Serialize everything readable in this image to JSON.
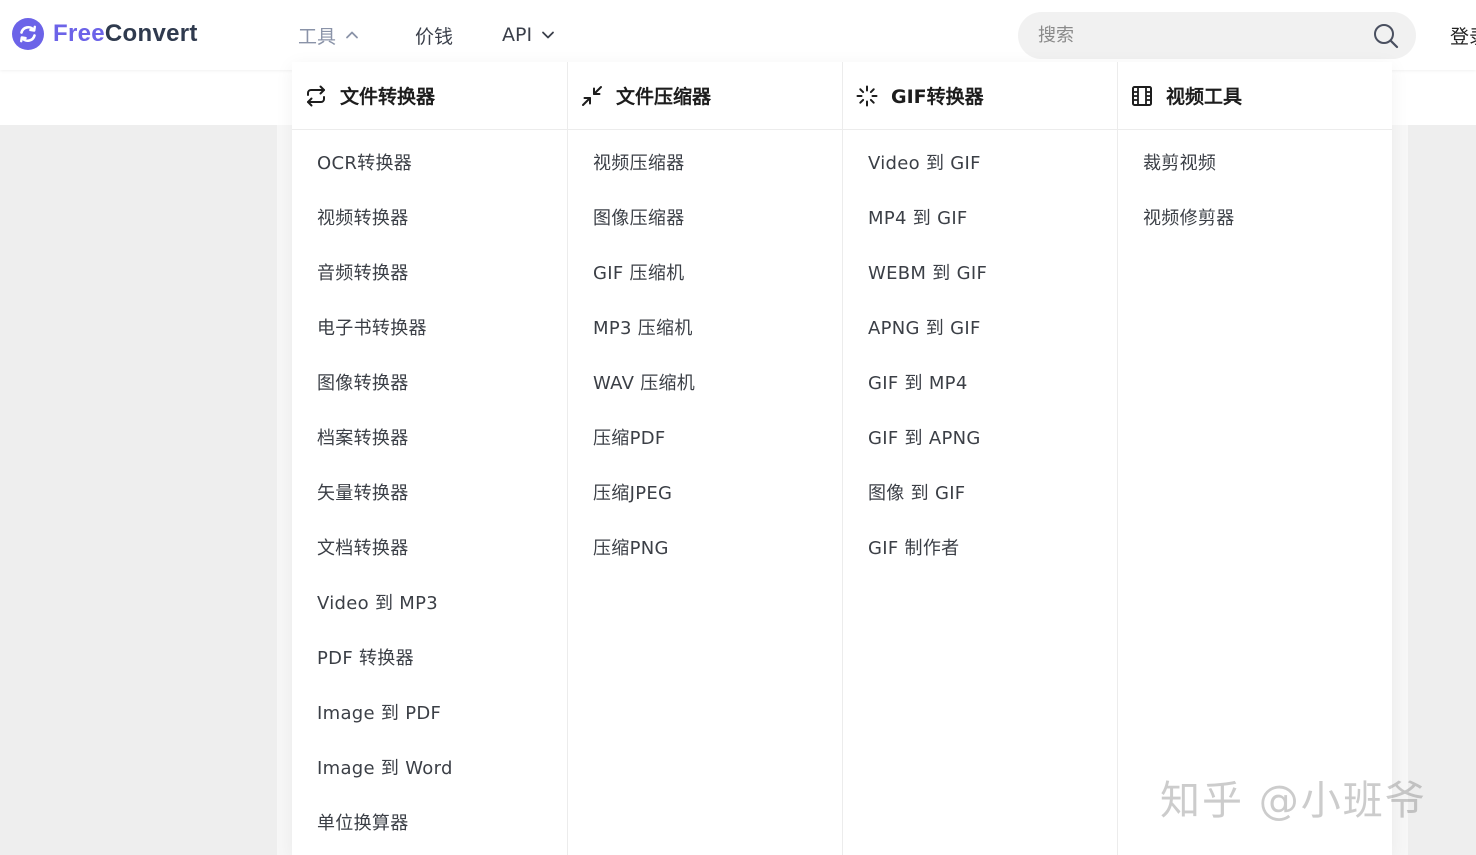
{
  "header": {
    "logo": {
      "free": "Free",
      "convert": "Convert"
    },
    "nav": {
      "tools_label": "工具",
      "price_label": "价钱",
      "api_label": "API"
    },
    "search": {
      "placeholder": "搜索"
    },
    "login_label": "登录"
  },
  "menu": {
    "columns": [
      {
        "title": "文件转换器",
        "icon": "convert-arrows-icon",
        "items": [
          "OCR转换器",
          "视频转换器",
          "音频转换器",
          "电子书转换器",
          "图像转换器",
          "档案转换器",
          "矢量转换器",
          "文档转换器",
          "Video 到 MP3",
          "PDF 转换器",
          "Image 到 PDF",
          "Image 到 Word",
          "单位换算器"
        ]
      },
      {
        "title": "文件压缩器",
        "icon": "compress-arrows-icon",
        "items": [
          "视频压缩器",
          "图像压缩器",
          "GIF 压缩机",
          "MP3 压缩机",
          "WAV 压缩机",
          "压缩PDF",
          "压缩JPEG",
          "压缩PNG"
        ]
      },
      {
        "title": "GIF转换器",
        "icon": "spinner-icon",
        "items": [
          "Video 到 GIF",
          "MP4 到 GIF",
          "WEBM 到 GIF",
          "APNG 到 GIF",
          "GIF 到 MP4",
          "GIF 到 APNG",
          "图像 到 GIF",
          "GIF 制作者"
        ]
      },
      {
        "title": "视频工具",
        "icon": "film-icon",
        "items": [
          "裁剪视频",
          "视频修剪器"
        ]
      }
    ]
  },
  "watermark": "知乎 @小班爷",
  "colors": {
    "brand": "#6c63e8",
    "brand_dark": "#2f3a4e",
    "nav_active": "#8a93a8"
  }
}
